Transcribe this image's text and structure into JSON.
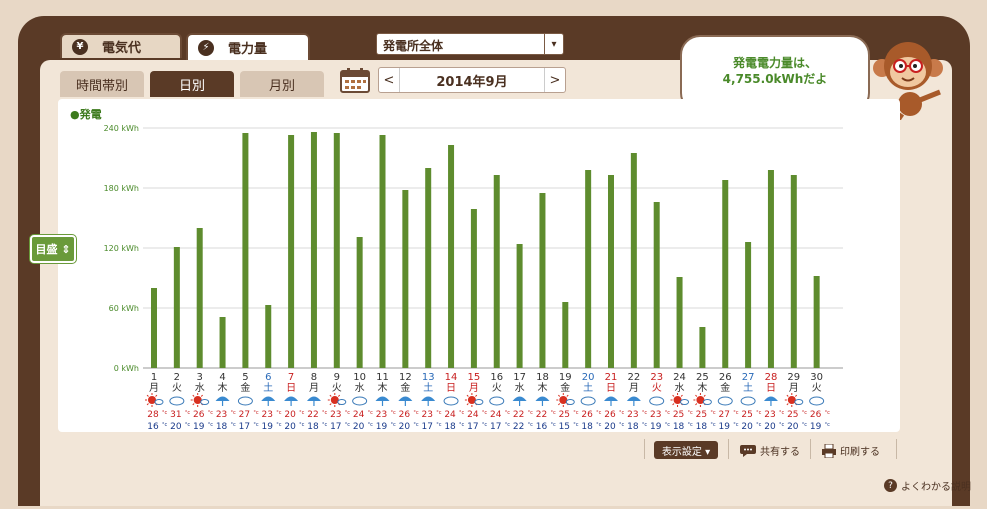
{
  "tabs": {
    "gas": "電気代",
    "power": "電力量",
    "gas_icon": "¥",
    "power_icon": "⚡"
  },
  "plant_select": {
    "value": "発電所全体"
  },
  "subtabs": {
    "time": "時間帯別",
    "day": "日別",
    "month": "月別"
  },
  "date_nav": {
    "label": "2014年9月",
    "prev": "<",
    "next": ">"
  },
  "bubble": {
    "line1": "発電電力量は、",
    "line2": "4,755.0kWhだよ"
  },
  "legend": "●発電",
  "metric_button": "目盛 ⇕",
  "footer": {
    "display_settings": "表示設定 ▾",
    "share": "共有する",
    "print": "印刷する",
    "help": "よくわかる説明"
  },
  "colors": {
    "bar": "#5e8c2e",
    "grid": "#d8d8d8",
    "weekday": "#333333",
    "saturday": "#2a6ab8",
    "sunday": "#c82020",
    "high": "#c82020",
    "low": "#1a3a8a"
  },
  "chart_data": {
    "type": "bar",
    "series": [
      {
        "name": "発電",
        "values": [
          80,
          121,
          140,
          51,
          235,
          63,
          233,
          236,
          235,
          131,
          233,
          178,
          200,
          223,
          159,
          193,
          124,
          175,
          66,
          198,
          193,
          215,
          166,
          91,
          41,
          188,
          126,
          198,
          193,
          92
        ]
      }
    ],
    "categories": [
      "1",
      "2",
      "3",
      "4",
      "5",
      "6",
      "7",
      "8",
      "9",
      "10",
      "11",
      "12",
      "13",
      "14",
      "15",
      "16",
      "17",
      "18",
      "19",
      "20",
      "21",
      "22",
      "23",
      "24",
      "25",
      "26",
      "27",
      "28",
      "29",
      "30"
    ],
    "weekdays": [
      "月",
      "火",
      "水",
      "木",
      "金",
      "土",
      "日",
      "月",
      "火",
      "水",
      "木",
      "金",
      "土",
      "日",
      "月",
      "火",
      "水",
      "木",
      "金",
      "土",
      "日",
      "月",
      "火",
      "水",
      "木",
      "金",
      "土",
      "日",
      "月",
      "火"
    ],
    "day_type": [
      "w",
      "w",
      "w",
      "w",
      "w",
      "sat",
      "sun",
      "w",
      "w",
      "w",
      "w",
      "w",
      "sat",
      "sun",
      "hol",
      "w",
      "w",
      "w",
      "w",
      "sat",
      "sun",
      "w",
      "hol",
      "w",
      "w",
      "w",
      "sat",
      "sun",
      "w",
      "w"
    ],
    "weather": [
      "sun",
      "cloud",
      "sun",
      "rain",
      "cloud",
      "rain",
      "rain",
      "rain",
      "sun",
      "cloud",
      "rain",
      "rain",
      "rain",
      "cloud",
      "sun",
      "cloud",
      "rain",
      "rain",
      "sun",
      "cloud",
      "rain",
      "rain",
      "cloud",
      "sun",
      "sun",
      "cloud",
      "cloud",
      "rain",
      "sun",
      "cloud"
    ],
    "high_temps": [
      28,
      31,
      26,
      23,
      27,
      23,
      20,
      22,
      23,
      24,
      23,
      26,
      23,
      24,
      24,
      24,
      22,
      22,
      25,
      26,
      26,
      23,
      23,
      25,
      25,
      27,
      25,
      23,
      25,
      26
    ],
    "low_temps": [
      16,
      20,
      19,
      18,
      17,
      19,
      20,
      18,
      17,
      20,
      19,
      20,
      17,
      18,
      17,
      17,
      22,
      16,
      15,
      18,
      20,
      18,
      19,
      18,
      18,
      19,
      20,
      20,
      20,
      19
    ],
    "y_ticks": [
      0,
      60,
      120,
      180,
      240
    ],
    "y_tick_labels": [
      "0 kWh",
      "60 kWh",
      "120 kWh",
      "180 kWh",
      "240 kWh"
    ],
    "ylim": [
      0,
      240
    ],
    "temp_unit": "°c"
  }
}
